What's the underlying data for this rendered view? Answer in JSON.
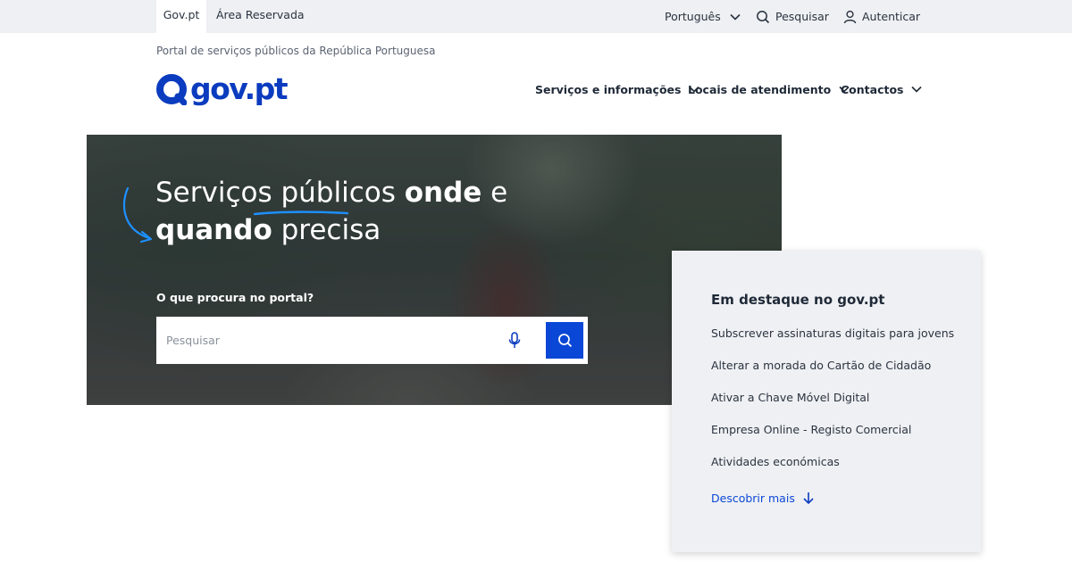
{
  "topbar": {
    "tabs": [
      {
        "label": "Gov.pt"
      },
      {
        "label": "Área Reservada"
      }
    ],
    "language": "Português",
    "search_label": "Pesquisar",
    "auth_label": "Autenticar"
  },
  "header": {
    "portal_subtitle": "Portal de serviços públicos da República Portuguesa",
    "logo_text": "gov.pt",
    "nav": [
      {
        "label": "Serviços e informações"
      },
      {
        "label": "Locais de atendimento"
      },
      {
        "label": "Contactos"
      }
    ]
  },
  "hero": {
    "title_part1": "Serviços públicos ",
    "title_bold1": "onde",
    "title_part2": " e",
    "title_bold2": "quando",
    "title_part3": " precisa",
    "question": "O que procura no portal?",
    "search_placeholder": "Pesquisar"
  },
  "featured": {
    "title": "Em destaque no gov.pt",
    "items": [
      {
        "label": "Subscrever assinaturas digitais para jovens"
      },
      {
        "label": "Alterar a morada do Cartão de Cidadão"
      },
      {
        "label": "Ativar a Chave Móvel Digital"
      },
      {
        "label": "Empresa Online - Registo Comercial"
      },
      {
        "label": "Atividades económicas"
      }
    ],
    "discover_label": "Descobrir mais"
  },
  "colors": {
    "brand_blue": "#0b3cbf",
    "button_blue": "#0b47d6",
    "accent_line": "#1e90ff",
    "topbar_bg": "#eef0f3"
  }
}
